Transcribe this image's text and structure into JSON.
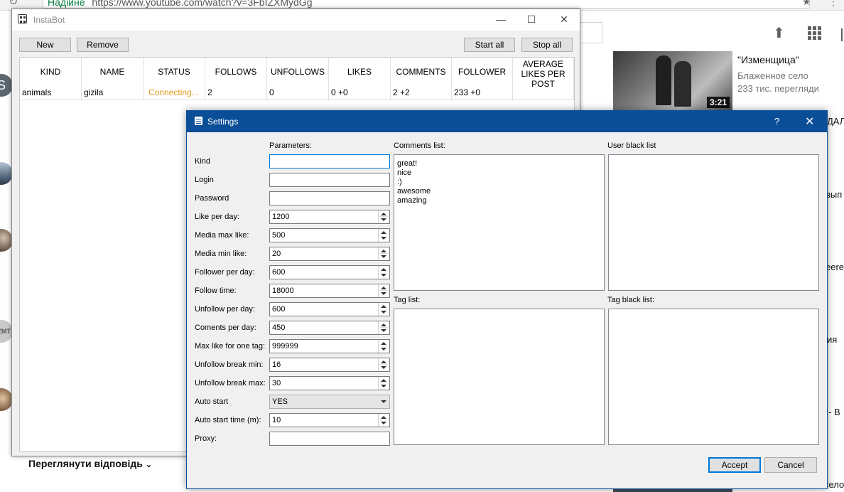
{
  "browser": {
    "secure_label": "Надійне",
    "url": "https://www.youtube.com/watch?v=3FbIZXMydGg"
  },
  "youtube": {
    "video_title": "\"Изменщица\"",
    "channel": "Блаженное село",
    "views": "233 тис. перегляди",
    "duration": "3:21",
    "show_replies": "Переглянути відповідь",
    "avatar_letter": "S",
    "avatar_tag": "ZMT",
    "fragments": [
      "ДАЛ",
      "вып",
      "eere",
      "ия",
      "- В",
      "село"
    ]
  },
  "instabot": {
    "title": "InstaBot",
    "buttons": {
      "new": "New",
      "remove": "Remove",
      "start_all": "Start all",
      "stop_all": "Stop all"
    },
    "columns": [
      "KIND",
      "NAME",
      "STATUS",
      "FOLLOWS",
      "UNFOLLOWS",
      "LIKES",
      "COMMENTS",
      "FOLLOWER",
      "AVERAGE LIKES PER POST"
    ],
    "rows": [
      {
        "kind": "animals",
        "name": "gizila",
        "status": "Connecting...",
        "follows": "2",
        "unfollows": "0",
        "likes": "0 +0",
        "comments": "2 +2",
        "follower": "233 +0",
        "avg_likes": ""
      }
    ],
    "status_color": "#e39a1b"
  },
  "settings": {
    "title": "Settings",
    "help": "?",
    "parameters_header": "Parameters:",
    "fields": {
      "kind": {
        "label": "Kind",
        "value": ""
      },
      "login": {
        "label": "Login",
        "value": ""
      },
      "password": {
        "label": "Password",
        "value": ""
      },
      "like_per_day": {
        "label": "Like per day:",
        "value": "1200"
      },
      "media_max_like": {
        "label": "Media max like:",
        "value": "500"
      },
      "media_min_like": {
        "label": "Media min like:",
        "value": "20"
      },
      "follower_per_day": {
        "label": "Follower per day:",
        "value": "600"
      },
      "follow_time": {
        "label": "Follow time:",
        "value": "18000"
      },
      "unfollow_per_day": {
        "label": "Unfollow per day:",
        "value": "600"
      },
      "coments_per_day": {
        "label": "Coments per day:",
        "value": "450"
      },
      "max_like_tag": {
        "label": "Max like for one tag:",
        "value": "999999"
      },
      "unfollow_break_min": {
        "label": "Unfollow break min:",
        "value": "16"
      },
      "unfollow_break_max": {
        "label": "Unfollow break max:",
        "value": "30"
      },
      "auto_start": {
        "label": "Auto start",
        "value": "YES"
      },
      "auto_start_time": {
        "label": "Auto start time (m):",
        "value": "10"
      },
      "proxy": {
        "label": "Proxy:",
        "value": ""
      }
    },
    "comments_list_label": "Comments list:",
    "comments": [
      "great!",
      "nice",
      ":)",
      "awesome",
      "amazing"
    ],
    "user_black_list_label": "User black list",
    "tag_list_label": "Tag list:",
    "tag_black_list_label": "Tag black list:",
    "accept": "Accept",
    "cancel": "Cancel",
    "accent_color": "#0b4e98"
  }
}
